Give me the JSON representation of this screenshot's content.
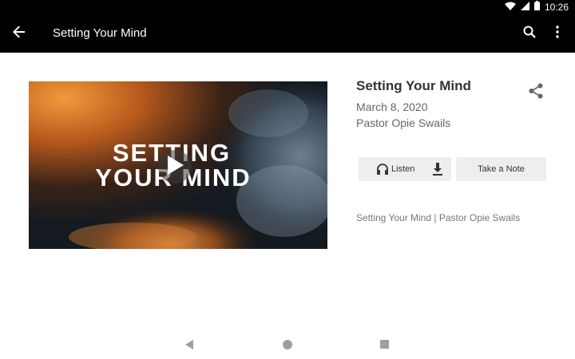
{
  "status_bar": {
    "time": "10:26",
    "icons": [
      "wifi-icon",
      "cell-signal-icon",
      "battery-icon"
    ]
  },
  "app_bar": {
    "title": "Setting Your Mind",
    "icons": [
      "back-arrow-icon",
      "search-icon",
      "more-vert-icon"
    ]
  },
  "media": {
    "thumbnail_text_line1": "SETTING",
    "thumbnail_text_line2": "YOUR MIND",
    "icon": "play-icon"
  },
  "sermon": {
    "title": "Setting Your Mind",
    "date": "March 8, 2020",
    "speaker": "Pastor Opie Swails",
    "share_icon": "share-icon",
    "description": "Setting Your Mind | Pastor Opie Swails"
  },
  "actions": {
    "listen_label": "Listen",
    "listen_icon": "headphones-icon",
    "download_icon": "download-icon",
    "note_label": "Take a Note"
  },
  "nav_bar": {
    "icons": [
      "nav-back-icon",
      "nav-home-icon",
      "nav-recents-icon"
    ]
  },
  "colors": {
    "app_bar": "#000000",
    "button_bg": "#eeeeee",
    "title_text": "#333333",
    "secondary_text": "#666666"
  }
}
